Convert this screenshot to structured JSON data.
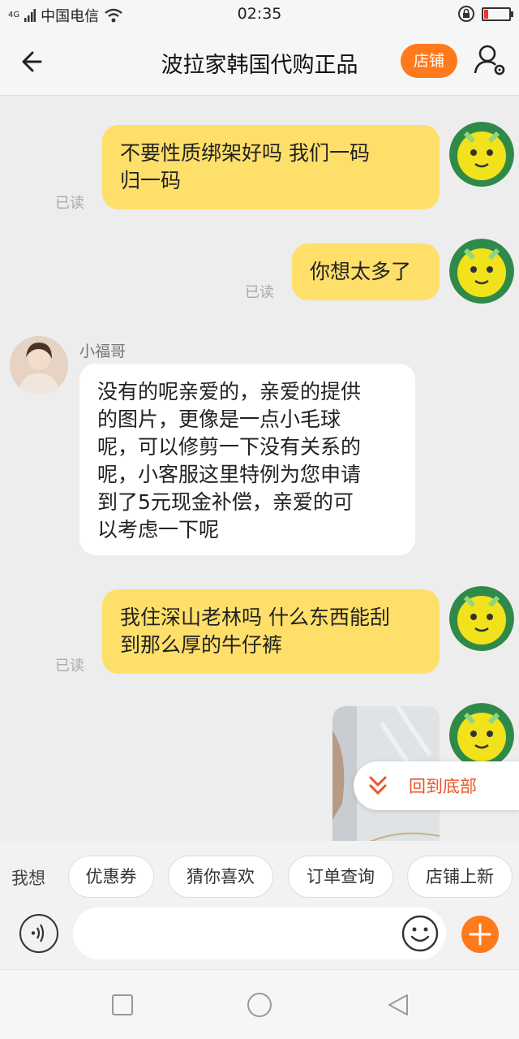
{
  "status_bar": {
    "network": "4G",
    "carrier": "中国电信",
    "time": "02:35"
  },
  "header": {
    "title": "波拉家韩国代购正品",
    "shop_button": "店铺"
  },
  "messages": [
    {
      "id": "m1",
      "direction": "out",
      "text_lines": [
        "不要性质绑架好吗  我们一码",
        "归一码"
      ],
      "status": "已读"
    },
    {
      "id": "m2",
      "direction": "out",
      "text_lines": [
        "你想太多了"
      ],
      "status": "已读"
    },
    {
      "id": "m3",
      "direction": "in",
      "sender": "小福哥",
      "text_lines": [
        "没有的呢亲爱的，亲爱的提供",
        "的图片，更像是一点小毛球",
        "呢，可以修剪一下没有关系的",
        "呢，小客服这里特例为您申请",
        "到了5元现金补偿，亲爱的可",
        "以考虑一下呢"
      ]
    },
    {
      "id": "m4",
      "direction": "out",
      "text_lines": [
        "我住深山老林吗 什么东西能刮",
        "到那么厚的牛仔裤"
      ],
      "status": "已读"
    },
    {
      "id": "m5",
      "direction": "out",
      "type": "image"
    }
  ],
  "back_to_bottom": "回到底部",
  "quick_bar": {
    "label": "我想",
    "chips": [
      "优惠券",
      "猜你喜欢",
      "订单查询",
      "店铺上新"
    ]
  },
  "input": {
    "placeholder": ""
  },
  "colors": {
    "accent_orange": "#ff7a1c",
    "outgoing_bubble": "#fedf6a",
    "incoming_bubble": "#ffffff",
    "back_to_bottom_text": "#e8572a"
  }
}
